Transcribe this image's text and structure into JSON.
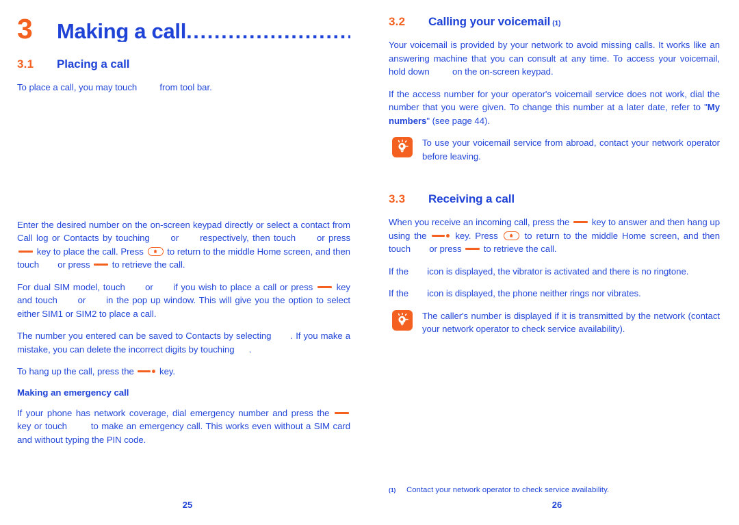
{
  "colors": {
    "accent_orange": "#f4601f",
    "text_blue": "#2347d8",
    "heading_blue": "#1f43d6",
    "background": "#ffffff"
  },
  "left_page": {
    "chapter": {
      "number": "3",
      "title": "Making a call",
      "leader": "........................"
    },
    "section_3_1": {
      "number": "3.1",
      "title": "Placing a call",
      "intro": {
        "before_icon": "To place a call, you may touch",
        "after_icon": "from tool bar."
      },
      "para_enter": {
        "p1": "Enter the desired number on the on-screen keypad directly or select a contact from Call log or Contacts by touching",
        "p2": "or",
        "p3": "respectively, then touch",
        "p4": "or press",
        "p5": "key to place the call. Press",
        "p6": "to return to the middle Home screen, and then touch",
        "p7": "or press",
        "p8": "to retrieve the call."
      },
      "para_dual_sim": {
        "p1": "For dual SIM model, touch",
        "p2": "or",
        "p3": "if you wish to place a call or press",
        "p4": "key and touch",
        "p5": "or",
        "p6": "in the pop up window. This will give you the option to select either SIM1 or SIM2 to place a call."
      },
      "para_save": {
        "p1": "The number you entered can be saved to Contacts by selecting",
        "p2": ". If you make a mistake, you can delete the incorrect digits by touching",
        "p3": "."
      },
      "para_hangup": {
        "p1": "To hang up the call, press the",
        "p2": "key."
      },
      "emergency": {
        "subhead": "Making an emergency call",
        "p1": "If your phone has network coverage, dial emergency number and press the",
        "p2": "key or touch",
        "p3": "to make an emergency call. This works even without a SIM card and without typing the PIN code."
      }
    },
    "folio": "25"
  },
  "right_page": {
    "section_3_2": {
      "number": "3.2",
      "title": "Calling your voicemail",
      "superscript": "(1)",
      "para_1": {
        "p1": "Your voicemail is provided by your network to avoid missing calls. It works like an answering machine that you can consult at any time. To access your voicemail, hold down",
        "p2": "on the on-screen keypad."
      },
      "para_2": {
        "p1": "If the access number for your operator's voicemail service does not work, dial the number that you were given. To change this number at a later date, refer to \"",
        "bold": "My numbers",
        "p2": "\" (see page 44)."
      },
      "tip": "To use your voicemail service from abroad, contact your network operator before leaving."
    },
    "section_3_3": {
      "number": "3.3",
      "title": "Receiving a call",
      "para_1": {
        "p1": "When you receive an incoming call, press the",
        "p2": "key to answer and then hang up using the",
        "p3": "key. Press",
        "p4": "to return to the middle Home screen, and then touch",
        "p5": "or press",
        "p6": "to retrieve the call."
      },
      "para_2": {
        "p1": "If the",
        "p2": "icon is displayed, the vibrator is activated and there is no ringtone."
      },
      "para_3": {
        "p1": "If the",
        "p2": "icon is displayed, the phone neither rings nor vibrates."
      },
      "tip": "The caller's number is displayed if it is transmitted by the network (contact your network operator to check service availability)."
    },
    "footnote": {
      "mark": "(1)",
      "text": "Contact your network operator to check service availability."
    },
    "folio": "26"
  },
  "icons": {
    "tip_icon": "lightbulb-icon",
    "call_key": "call-key-icon",
    "hangup_key": "hangup-key-icon",
    "home_key": "home-key-icon"
  }
}
